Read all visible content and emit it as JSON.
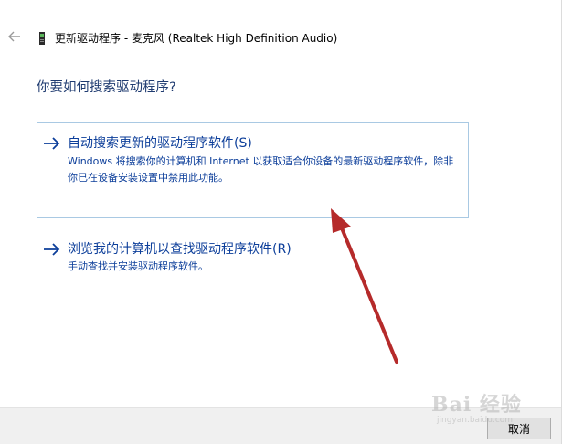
{
  "window": {
    "title": "更新驱动程序 - 麦克风 (Realtek High Definition Audio)",
    "back_icon": "back-arrow-icon",
    "device_icon": "microphone-device-icon"
  },
  "heading": "你要如何搜索驱动程序?",
  "options": [
    {
      "title": "自动搜索更新的驱动程序软件(S)",
      "description": "Windows 将搜索你的计算机和 Internet 以获取适合你设备的最新驱动程序软件，除非你已在设备安装设置中禁用此功能。",
      "icon": "right-arrow-icon"
    },
    {
      "title": "浏览我的计算机以查找驱动程序软件(R)",
      "description": "手动查找并安装驱动程序软件。",
      "icon": "right-arrow-icon"
    }
  ],
  "footer": {
    "cancel_label": "取消"
  },
  "watermark": {
    "logo": "Bai 经验",
    "sub": "jingyan.baidu.com"
  },
  "colors": {
    "link_blue": "#0c3e9a",
    "heading_blue": "#1f3b70",
    "option_border": "#a9c9e3",
    "annotation_red": "#b52a2a",
    "footer_bg": "#f0f0f0"
  }
}
